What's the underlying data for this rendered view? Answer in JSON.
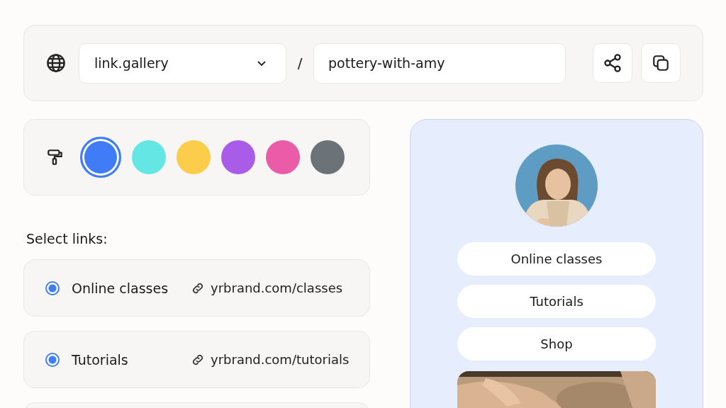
{
  "url_bar": {
    "domain": "link.gallery",
    "separator": "/",
    "slug": "pottery-with-amy"
  },
  "theme": {
    "swatches": [
      {
        "color": "#3f7cf6",
        "selected": true
      },
      {
        "color": "#63e6e4",
        "selected": false
      },
      {
        "color": "#fccd4a",
        "selected": false
      },
      {
        "color": "#a95ce8",
        "selected": false
      },
      {
        "color": "#ea5ba8",
        "selected": false
      },
      {
        "color": "#6b7378",
        "selected": false
      }
    ]
  },
  "links_heading": "Select links:",
  "links": [
    {
      "label": "Online classes",
      "url": "yrbrand.com/classes",
      "selected": true
    },
    {
      "label": "Tutorials",
      "url": "yrbrand.com/tutorials",
      "selected": true
    }
  ],
  "preview": {
    "buttons": [
      "Online classes",
      "Tutorials",
      "Shop"
    ]
  }
}
